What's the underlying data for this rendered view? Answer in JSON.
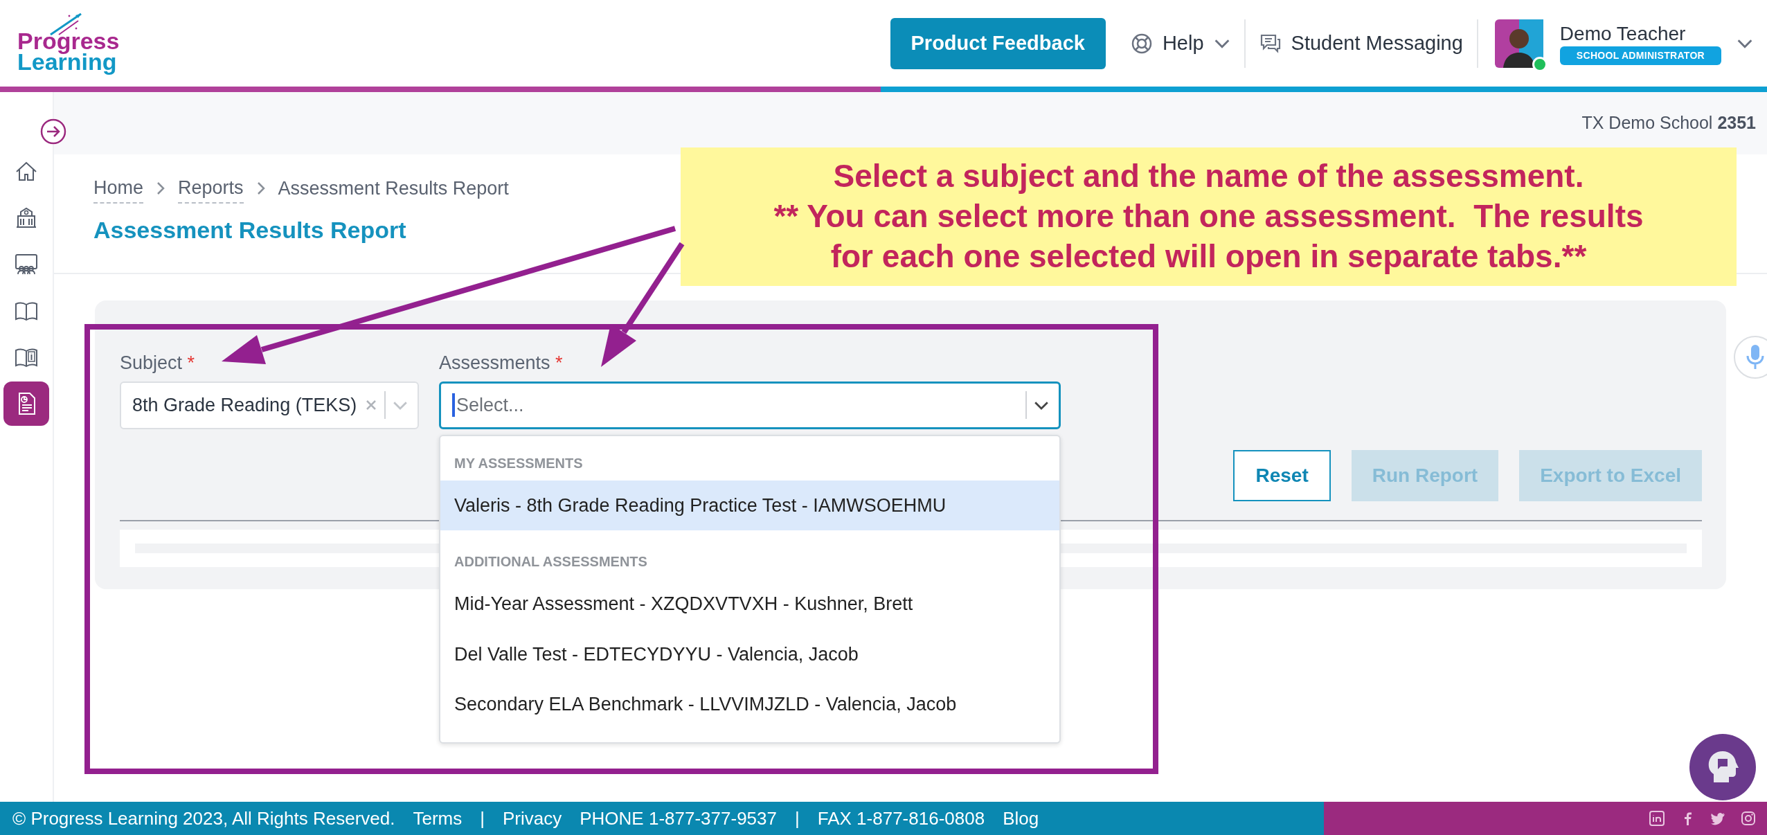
{
  "header": {
    "logo": {
      "line_1": "Progress",
      "line_2": "Learning"
    },
    "feedback_button": "Product Feedback",
    "help": "Help",
    "messaging": "Student Messaging",
    "user": {
      "name": "Demo Teacher",
      "role": "SCHOOL ADMINISTRATOR",
      "online": true
    }
  },
  "school": "TX Demo School **2351**",
  "sidebar": {
    "items": [
      {
        "kind": "home",
        "selected": false
      },
      {
        "kind": "school",
        "selected": false
      },
      {
        "kind": "classroom",
        "selected": false
      },
      {
        "kind": "book",
        "selected": false
      },
      {
        "kind": "book-info",
        "selected": false
      },
      {
        "kind": "report",
        "selected": true
      }
    ]
  },
  "breadcrumb": [
    {
      "label": "Home",
      "link": true
    },
    {
      "label": "Reports",
      "link": true
    },
    {
      "label": "Assessment Results Report",
      "link": false
    }
  ],
  "page_title": "Assessment Results Report",
  "form": {
    "fields": [
      {
        "label": "Subject",
        "required_mark": "*",
        "value": "8th Grade Reading (TEKS)",
        "focused": false,
        "clearable": true
      },
      {
        "label": "Assessments",
        "required_mark": "*",
        "placeholder": "Select...",
        "focused": true,
        "clearable": false
      }
    ]
  },
  "dropdown": {
    "groups": [
      {
        "heading": "MY ASSESSMENTS",
        "options": [
          {
            "label": "Valeris - 8th Grade Reading Practice Test - IAMWSOEHMU",
            "selected": true
          }
        ]
      },
      {
        "heading": "ADDITIONAL ASSESSMENTS",
        "options": [
          {
            "label": "Mid-Year Assessment - XZQDXVTVXH - Kushner, Brett",
            "selected": false
          },
          {
            "label": "Del Valle Test - EDTECYDYYU - Valencia, Jacob",
            "selected": false
          },
          {
            "label": "Secondary ELA Benchmark - LLVVIMJZLD - Valencia, Jacob",
            "selected": false
          }
        ]
      }
    ]
  },
  "buttons": [
    {
      "label": "Reset",
      "disabled": false
    },
    {
      "label": "Run Report",
      "disabled": true
    },
    {
      "label": "Export to Excel",
      "disabled": true
    }
  ],
  "footer": {
    "items": [
      "© Progress Learning 2023, All Rights Reserved.",
      "Terms",
      "|",
      "Privacy",
      "PHONE 1-877-377-9537",
      "|",
      "FAX 1-877-816-0808",
      "Blog"
    ],
    "social": [
      {
        "kind": "linkedin"
      },
      {
        "kind": "facebook"
      },
      {
        "kind": "twitter"
      },
      {
        "kind": "instagram"
      }
    ]
  },
  "annotation": {
    "lines": [
      "Select a subject and the name of the assessment.",
      "** You can select more than one assessment.  The results",
      "for each one selected will open in separate tabs.**"
    ]
  }
}
